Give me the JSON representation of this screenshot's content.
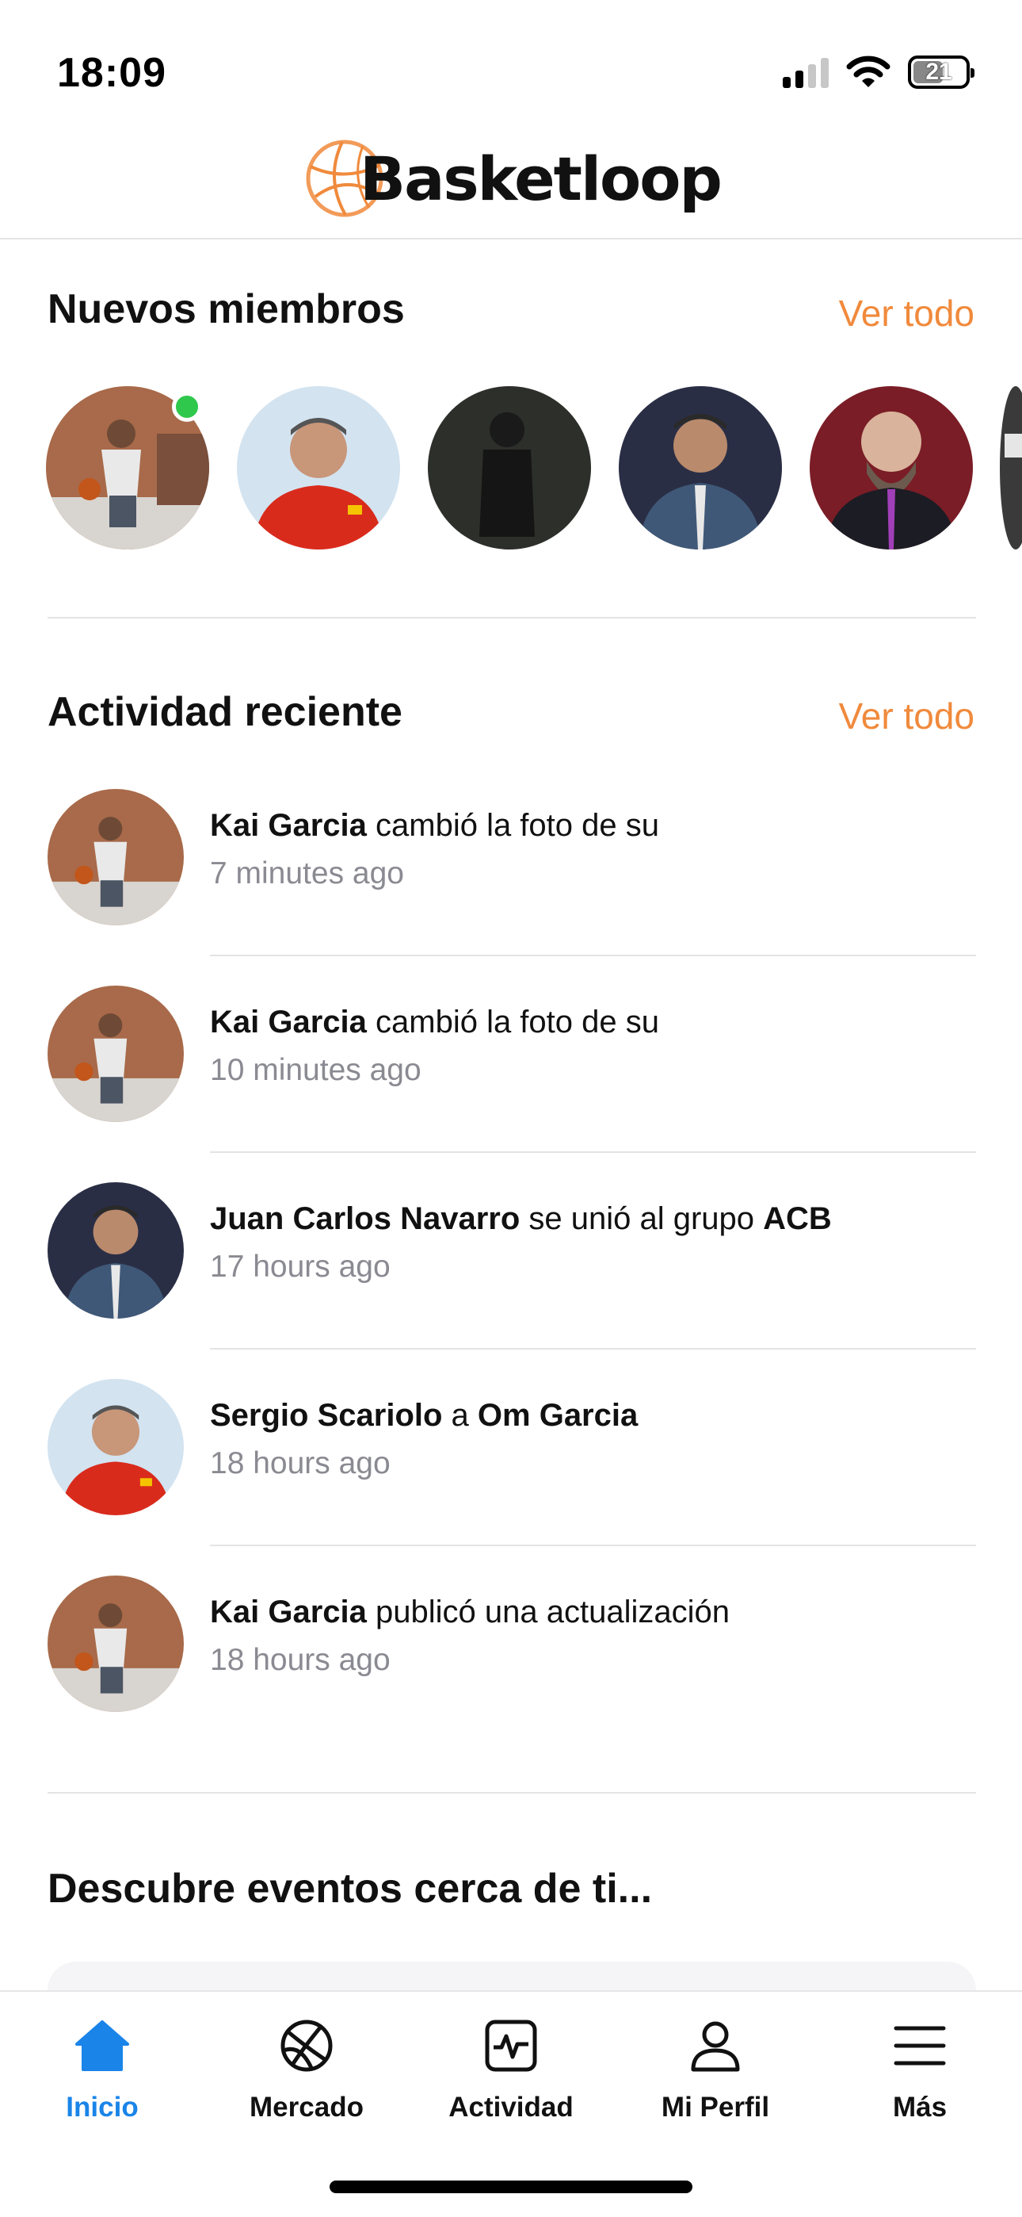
{
  "status_bar": {
    "time": "18:09",
    "battery": "21"
  },
  "header": {
    "logo_text": "Basketloop",
    "logo_icon": "basketball-icon",
    "accent_color": "#f08a3c"
  },
  "new_members": {
    "title": "Nuevos miembros",
    "see_all": "Ver todo",
    "online_color": "#2fc84c"
  },
  "recent_activity": {
    "title": "Actividad reciente",
    "see_all": "Ver todo",
    "items": [
      {
        "actor": "Kai Garcia",
        "text": " cambió la foto de su",
        "time": "7 minutes ago"
      },
      {
        "actor": "Kai Garcia",
        "text": " cambió la foto de su",
        "time": "10 minutes ago"
      },
      {
        "actor": "Juan Carlos Navarro",
        "text": " se unió al grupo ",
        "target": "ACB",
        "time": "17 hours ago"
      },
      {
        "actor": "Sergio Scariolo",
        "text": " a ",
        "target": "Om Garcia",
        "time": "18 hours ago"
      },
      {
        "actor": "Kai Garcia",
        "text": " publicó una actualización",
        "time": "18 hours ago"
      }
    ]
  },
  "events": {
    "title": "Descubre eventos cerca de ti..."
  },
  "tab_bar": {
    "active_color": "#1a84e8",
    "tabs": [
      {
        "label": "Inicio",
        "icon": "home-icon",
        "active": true
      },
      {
        "label": "Mercado",
        "icon": "basketball-icon"
      },
      {
        "label": "Actividad",
        "icon": "activity-icon"
      },
      {
        "label": "Mi Perfil",
        "icon": "profile-icon"
      },
      {
        "label": "Más",
        "icon": "menu-icon"
      }
    ]
  }
}
